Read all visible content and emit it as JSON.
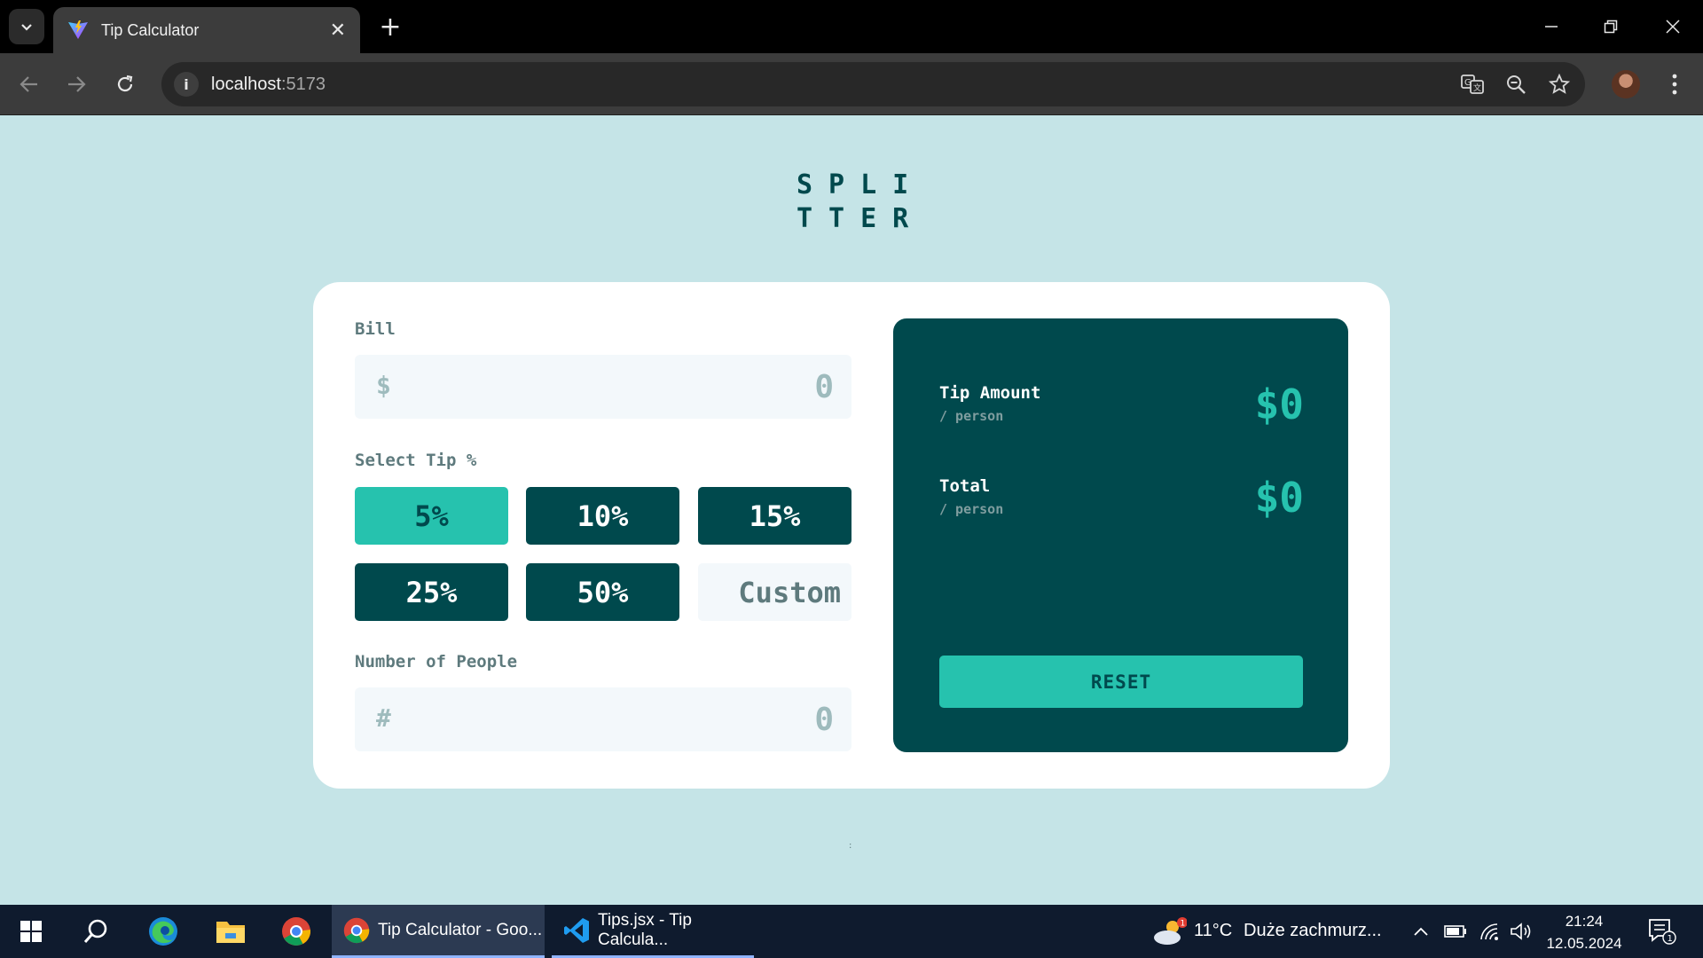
{
  "browser": {
    "tab_title": "Tip Calculator",
    "url_host": "localhost",
    "url_port": ":5173"
  },
  "app": {
    "logo_line1": "SPLI",
    "logo_line2": "TTER",
    "bill": {
      "label": "Bill",
      "icon": "$",
      "placeholder": "0"
    },
    "tip": {
      "label": "Select Tip %",
      "options": [
        "5%",
        "10%",
        "15%",
        "25%",
        "50%"
      ],
      "selected": "5%",
      "custom_placeholder": "Custom"
    },
    "people": {
      "label": "Number of People",
      "icon": "#",
      "placeholder": "0"
    },
    "results": {
      "tip_label": "Tip Amount",
      "tip_sub": "/ person",
      "tip_value": "$0",
      "total_label": "Total",
      "total_sub": "/ person",
      "total_value": "$0",
      "reset_label": "RESET"
    },
    "colors": {
      "background": "#c5e4e7",
      "dark_cyan": "#00494d",
      "strong_cyan": "#26c2ae"
    }
  },
  "taskbar": {
    "chrome_window": "Tip Calculator - Goo...",
    "vscode_window": "Tips.jsx - Tip Calcula...",
    "weather_temp": "11°C",
    "weather_desc": "Duże zachmurz...",
    "weather_badge": "1",
    "time": "21:24",
    "date": "12.05.2024",
    "notifications": "1"
  },
  "icons": [
    "tab-search-icon",
    "vite-logo-icon",
    "close-icon",
    "plus-icon",
    "minimize-icon",
    "restore-icon",
    "back-arrow-icon",
    "forward-arrow-icon",
    "reload-icon",
    "info-icon",
    "translate-icon",
    "zoom-icon",
    "star-icon",
    "kebab-menu-icon",
    "windows-start-icon",
    "search-icon",
    "edge-icon",
    "file-explorer-icon",
    "chrome-icon",
    "vscode-icon",
    "weather-icon",
    "chevron-up-icon",
    "battery-icon",
    "wifi-icon",
    "speaker-icon",
    "notification-icon"
  ]
}
